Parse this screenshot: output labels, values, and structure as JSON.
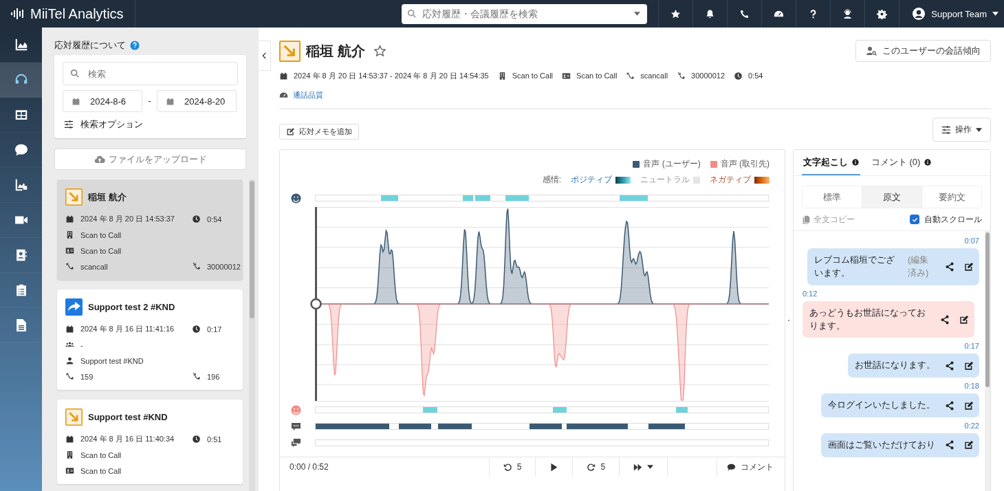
{
  "app": {
    "logo": "MiiTel Analytics",
    "search": {
      "placeholder": "応対履歴・会議履歴を検索"
    },
    "user": "Support Team"
  },
  "rail": [
    {
      "kind": "analytics",
      "selected": false
    },
    {
      "kind": "calls",
      "selected": true
    },
    {
      "kind": "dashboard",
      "selected": false
    },
    {
      "kind": "sms",
      "selected": false
    },
    {
      "kind": "media",
      "selected": false
    },
    {
      "kind": "video",
      "selected": false
    },
    {
      "kind": "contacts",
      "selected": false
    },
    {
      "kind": "tasks",
      "selected": false
    },
    {
      "kind": "documents",
      "selected": false
    }
  ],
  "sidebar": {
    "heading": "応対履歴について",
    "search": {
      "placeholder": "検索"
    },
    "date_from": "2024-8-6",
    "date_separator": "-",
    "date_to": "2024-8-20",
    "options": "検索オプション",
    "upload": "ファイルをアップロード",
    "calls": [
      {
        "kind": "incoming",
        "selected": true,
        "name": "稲垣 航介",
        "datetime": "2024 年 8 月 20 日 14:53:37",
        "duration": "0:54",
        "company": "Scan to Call",
        "contact": "Scan to Call",
        "caller": "scancall",
        "callee": "30000012"
      },
      {
        "kind": "outgoing",
        "selected": false,
        "name": "Support test 2 #KND",
        "datetime": "2024 年 8 月 16 日 11:41:16",
        "duration": "0:17",
        "group": "-",
        "user": "Support test #KND",
        "caller": "159",
        "callee": "196"
      },
      {
        "kind": "incoming",
        "selected": false,
        "name": "Support test #KND",
        "datetime": "2024 年 8 月 16 日 11:40:34",
        "duration": "0:51",
        "company": "Scan to Call",
        "contact": "Scan to Call"
      }
    ]
  },
  "detail": {
    "kind": "incoming",
    "name": "稲垣 航介",
    "starred": false,
    "trend_button": "このユーザーの会話傾向",
    "period": "2024 年 8 月 20 日 14:53:37 - 2024 年 8 月 20 日 14:54:35",
    "company": "Scan to Call",
    "contact": "Scan to Call",
    "caller": "scancall",
    "callee": "30000012",
    "duration": "0:54",
    "quality_link": "通話品質",
    "memo_button": "応対メモを追加",
    "actions_button": "操作"
  },
  "waveform": {
    "legend": [
      {
        "label": "音声 (ユーザー)",
        "color": "#3d5a73"
      },
      {
        "label": "音声 (取引先)",
        "color": "#f08c88"
      }
    ],
    "sentiment_label": "感情:",
    "sentiment_legend": [
      {
        "kind": "positive",
        "label": "ポジティブ"
      },
      {
        "kind": "neutral",
        "label": "ニュートラル"
      },
      {
        "kind": "negative",
        "label": "ネガティブ"
      }
    ]
  },
  "player": {
    "time": "0:00 / 0:52",
    "rewind": "5",
    "forward": "5",
    "comment": "コメント"
  },
  "transcript": {
    "tabs": [
      {
        "label": "文字起こし",
        "selected": true
      },
      {
        "label": "コメント (0)",
        "selected": false
      }
    ],
    "modes": [
      {
        "label": "標準",
        "selected": false
      },
      {
        "label": "原文",
        "selected": true
      },
      {
        "label": "要約文",
        "selected": false
      }
    ],
    "copy": "全文コピー",
    "autoscroll": {
      "label": "自動スクロール",
      "checked": true
    },
    "messages": [
      {
        "kind": "user",
        "time": "0:07",
        "text": "レブコム稲垣でございます。",
        "note": "(編集済み)"
      },
      {
        "kind": "customer",
        "time": "0:12",
        "text": "あっどうもお世話になっております。"
      },
      {
        "kind": "user",
        "time": "0:17",
        "text": "お世話になります。"
      },
      {
        "kind": "user",
        "time": "0:18",
        "text": "今ログインいたしました。"
      },
      {
        "kind": "user",
        "time": "0:22",
        "text": "画面はご覧いただけており"
      }
    ]
  }
}
